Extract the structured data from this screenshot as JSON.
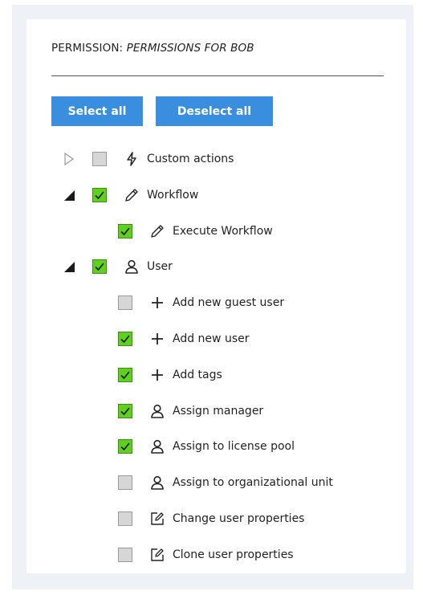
{
  "header": {
    "title_prefix": "PERMISSION: ",
    "title_value": "PERMISSIONS FOR BOB"
  },
  "buttons": {
    "select_all": "Select all",
    "deselect_all": "Deselect all"
  },
  "colors": {
    "accent": "#3a8ee0",
    "checked": "#5fd01d",
    "unchecked": "#d6d6d6"
  },
  "tree": [
    {
      "label": "Custom actions",
      "icon": "lightning-icon",
      "checked": false,
      "expanded": false,
      "level": 0
    },
    {
      "label": "Workflow",
      "icon": "pencil-icon",
      "checked": true,
      "expanded": true,
      "level": 0
    },
    {
      "label": "Execute Workflow",
      "icon": "pencil-icon",
      "checked": true,
      "level": 1
    },
    {
      "label": "User",
      "icon": "user-icon",
      "checked": true,
      "expanded": true,
      "level": 0
    },
    {
      "label": "Add new guest user",
      "icon": "plus-icon",
      "checked": false,
      "level": 1
    },
    {
      "label": "Add new user",
      "icon": "plus-icon",
      "checked": true,
      "level": 1
    },
    {
      "label": "Add tags",
      "icon": "plus-icon",
      "checked": true,
      "level": 1
    },
    {
      "label": "Assign manager",
      "icon": "user-icon",
      "checked": true,
      "level": 1
    },
    {
      "label": "Assign to license pool",
      "icon": "user-icon",
      "checked": true,
      "level": 1
    },
    {
      "label": "Assign to organizational unit",
      "icon": "user-icon",
      "checked": false,
      "level": 1
    },
    {
      "label": "Change user properties",
      "icon": "edit-icon",
      "checked": false,
      "level": 1
    },
    {
      "label": "Clone user properties",
      "icon": "edit-icon",
      "checked": false,
      "level": 1
    }
  ]
}
